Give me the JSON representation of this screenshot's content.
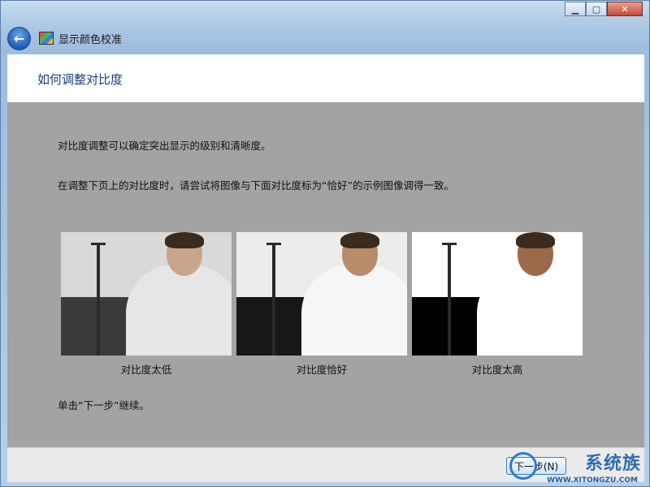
{
  "window": {
    "app_title": "显示颜色校准",
    "caption": {
      "minimize": "▁",
      "maximize": "▢",
      "close": "✕"
    }
  },
  "page": {
    "title": "如何调整对比度",
    "paragraph1": "对比度调整可以确定突出显示的级别和清晰度。",
    "paragraph2": "在调整下页上的对比度时，请尝试将图像与下面对比度标为“恰好”的示例图像调得一致。",
    "paragraph3": "单击“下一步”继续。"
  },
  "examples": [
    {
      "label": "对比度太低",
      "top_color": "#d9d9d9",
      "bottom_color": "#3a3a3a",
      "shirt": "#e6e6e6",
      "skin": "#c9a58c"
    },
    {
      "label": "对比度恰好",
      "top_color": "#ececec",
      "bottom_color": "#171717",
      "shirt": "#f6f6f6",
      "skin": "#b98c6c"
    },
    {
      "label": "对比度太高",
      "top_color": "#ffffff",
      "bottom_color": "#000000",
      "shirt": "#ffffff",
      "skin": "#9b6a4a"
    }
  ],
  "footer": {
    "next_label": "下一步(N)"
  },
  "watermark": {
    "brand": "系统族",
    "url": "WWW.XITONGZU.COM"
  }
}
